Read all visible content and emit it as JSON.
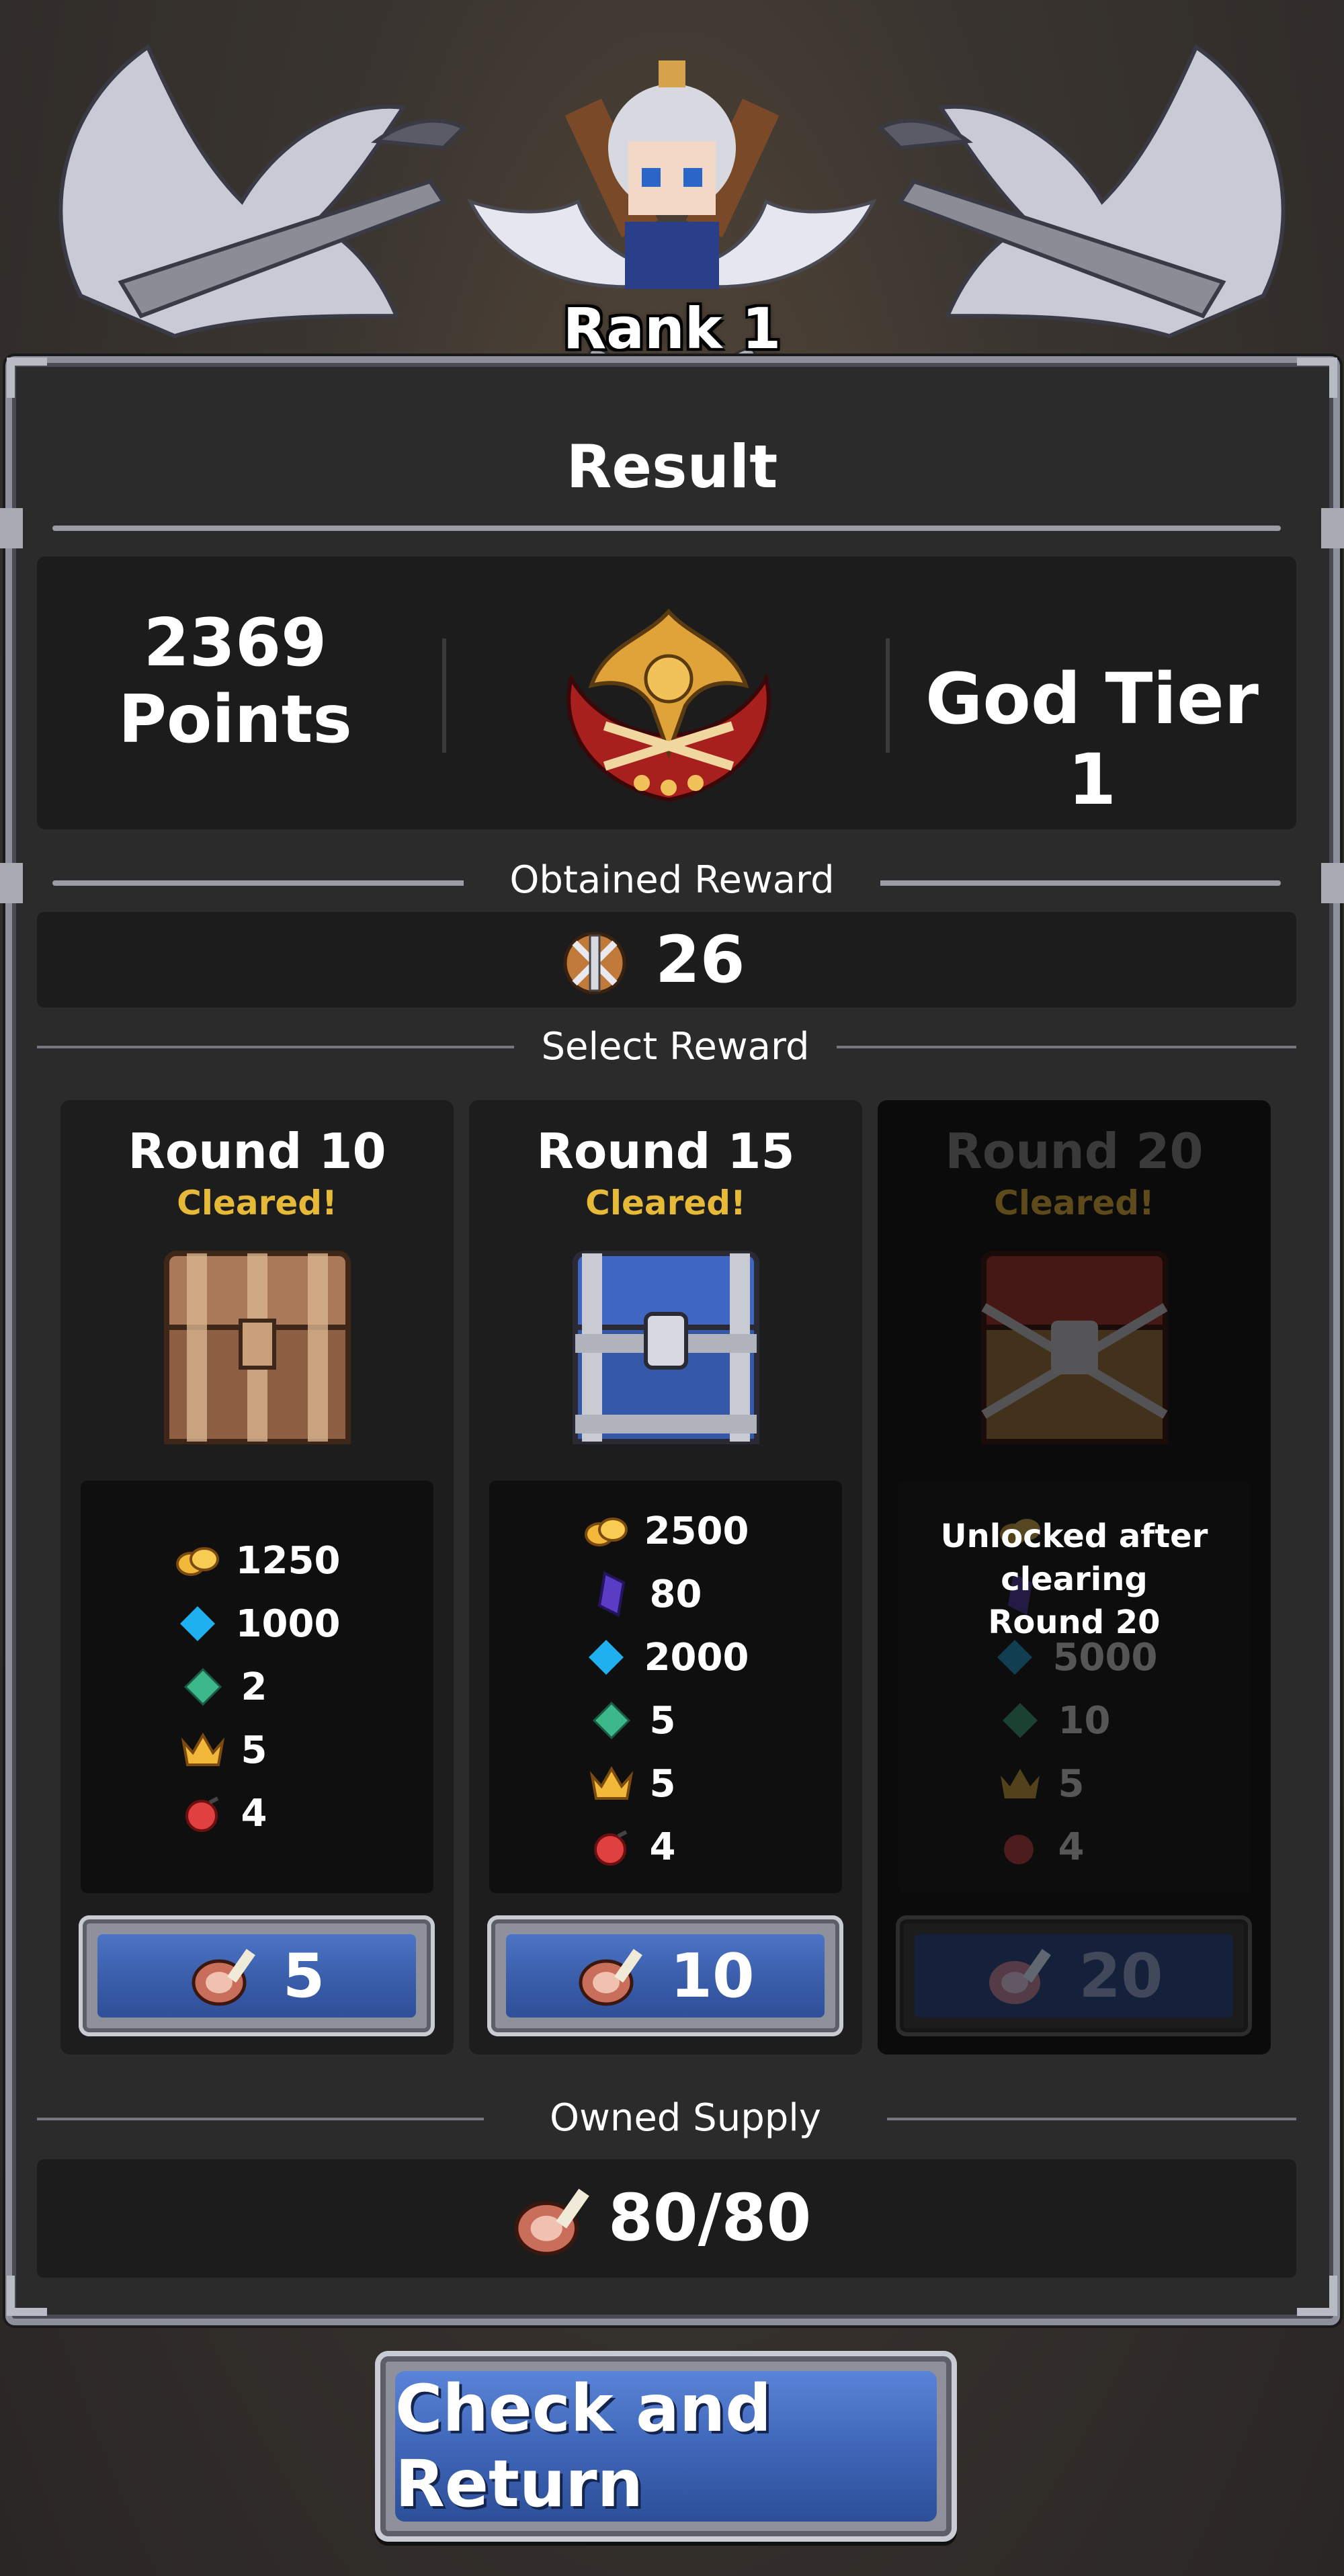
{
  "crest": {
    "rank_label": "Rank 1"
  },
  "header": {
    "title": "Result"
  },
  "score": {
    "points_value": "2369",
    "points_unit": "Points",
    "tier": "God Tier 1"
  },
  "obtained": {
    "label": "Obtained Reward",
    "value": "26",
    "icon": "crossed-swords-badge-icon"
  },
  "select": {
    "label": "Select Reward"
  },
  "cards": [
    {
      "title": "Round 10",
      "status": "Cleared!",
      "chest": "wooden-chest-icon",
      "items": [
        {
          "icon": "gold-coins-icon",
          "value": "1250"
        },
        {
          "icon": "blue-diamond-icon",
          "value": "1000"
        },
        {
          "icon": "green-gem-icon",
          "value": "2"
        },
        {
          "icon": "crown-icon",
          "value": "5"
        },
        {
          "icon": "red-orb-icon",
          "value": "4"
        }
      ],
      "cost": "5",
      "cost_icon": "meat-icon"
    },
    {
      "title": "Round 15",
      "status": "Cleared!",
      "chest": "silver-chest-icon",
      "items": [
        {
          "icon": "gold-coins-icon",
          "value": "2500"
        },
        {
          "icon": "purple-crystal-icon",
          "value": "80"
        },
        {
          "icon": "blue-diamond-icon",
          "value": "2000"
        },
        {
          "icon": "green-gem-icon",
          "value": "5"
        },
        {
          "icon": "crown-icon",
          "value": "5"
        },
        {
          "icon": "red-orb-icon",
          "value": "4"
        }
      ],
      "cost": "10",
      "cost_icon": "meat-icon"
    },
    {
      "title": "Round 20",
      "status": "Cleared!",
      "chest": "locked-red-chest-icon",
      "locked_message": [
        "Unlocked after",
        "clearing",
        "Round 20"
      ],
      "items": [
        {
          "icon": "gold-coins-icon",
          "value": ""
        },
        {
          "icon": "purple-crystal-icon",
          "value": ""
        },
        {
          "icon": "blue-diamond-icon",
          "value": "5000"
        },
        {
          "icon": "green-gem-icon",
          "value": "10"
        },
        {
          "icon": "crown-icon",
          "value": "5"
        },
        {
          "icon": "red-orb-icon",
          "value": "4"
        }
      ],
      "cost": "20",
      "cost_icon": "meat-icon"
    }
  ],
  "supply": {
    "label": "Owned Supply",
    "value": "80/80"
  },
  "footer": {
    "button_label": "Check and Return"
  }
}
